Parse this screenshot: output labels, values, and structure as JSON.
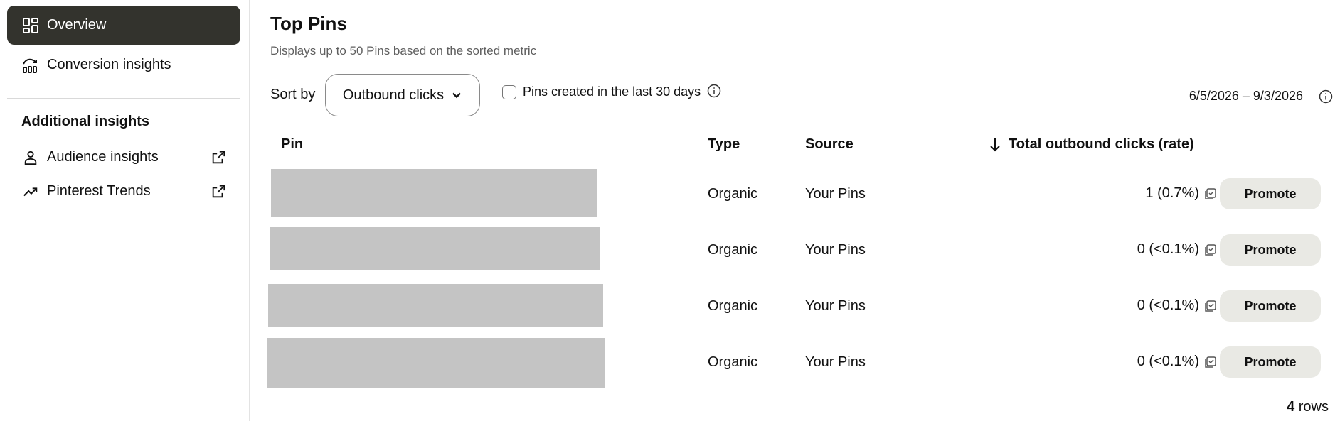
{
  "sidebar": {
    "items": [
      {
        "label": "Overview",
        "icon": "dashboard-icon",
        "active": true
      },
      {
        "label": "Conversion insights",
        "icon": "conversion-chart-icon",
        "active": false
      }
    ],
    "section_title": "Additional insights",
    "additional": [
      {
        "label": "Audience insights",
        "icon": "person-icon",
        "external_icon": "external-link-icon"
      },
      {
        "label": "Pinterest Trends",
        "icon": "trend-arrow-icon",
        "external_icon": "external-link-icon"
      }
    ],
    "active_bg": "#33332d"
  },
  "main": {
    "title": "Top Pins",
    "subtitle": "Displays up to 50 Pins based on the sorted metric",
    "sort_label": "Sort by",
    "sort_value": "Outbound clicks",
    "checkbox_label": "Pins created in the last 30 days",
    "checkbox_checked": false,
    "date_range": "6/5/2026 – 9/3/2026",
    "table": {
      "columns": [
        "Pin",
        "Type",
        "Source",
        "Total outbound clicks (rate)"
      ],
      "sort_indicator": "arrow-down-icon",
      "rows": [
        {
          "type": "Organic",
          "source": "Your Pins",
          "metric": "1 (0.7%)",
          "action": "Promote"
        },
        {
          "type": "Organic",
          "source": "Your Pins",
          "metric": "0 (<0.1%)",
          "action": "Promote"
        },
        {
          "type": "Organic",
          "source": "Your Pins",
          "metric": "0 (<0.1%)",
          "action": "Promote"
        },
        {
          "type": "Organic",
          "source": "Your Pins",
          "metric": "0 (<0.1%)",
          "action": "Promote"
        }
      ]
    },
    "rows_count": "4",
    "rows_suffix": " rows"
  }
}
